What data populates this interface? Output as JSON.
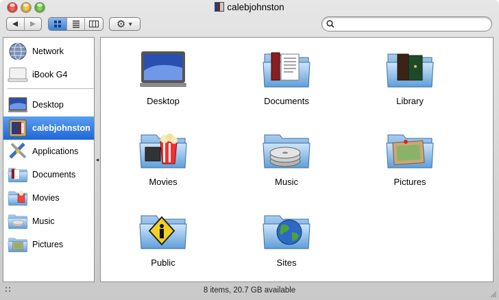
{
  "window": {
    "title": "calebjohnston"
  },
  "toolbar": {
    "back_glyph": "◀",
    "forward_glyph": "▶",
    "action_glyph": "⚙",
    "search_placeholder": ""
  },
  "sidebar": {
    "devices": [
      {
        "label": "Network",
        "icon": "network-globe-icon"
      },
      {
        "label": "iBook G4",
        "icon": "laptop-icon"
      }
    ],
    "places": [
      {
        "label": "Desktop",
        "icon": "desktop-icon"
      },
      {
        "label": "calebjohnston",
        "icon": "home-icon",
        "selected": true
      },
      {
        "label": "Applications",
        "icon": "applications-icon"
      },
      {
        "label": "Documents",
        "icon": "documents-folder-icon"
      },
      {
        "label": "Movies",
        "icon": "movies-folder-icon"
      },
      {
        "label": "Music",
        "icon": "music-folder-icon"
      },
      {
        "label": "Pictures",
        "icon": "pictures-folder-icon"
      }
    ]
  },
  "content": {
    "items": [
      {
        "label": "Desktop",
        "icon": "desktop-icon"
      },
      {
        "label": "Documents",
        "icon": "documents-folder-icon"
      },
      {
        "label": "Library",
        "icon": "library-folder-icon"
      },
      {
        "label": "Movies",
        "icon": "movies-folder-icon"
      },
      {
        "label": "Music",
        "icon": "music-folder-icon"
      },
      {
        "label": "Pictures",
        "icon": "pictures-folder-icon"
      },
      {
        "label": "Public",
        "icon": "public-folder-icon"
      },
      {
        "label": "Sites",
        "icon": "sites-folder-icon"
      }
    ]
  },
  "status": {
    "text": "8 items, 20.7 GB available"
  },
  "colors": {
    "selection": "#2f78dc",
    "folder": "#8fbde8",
    "window_bg": "#d4d4d4"
  }
}
